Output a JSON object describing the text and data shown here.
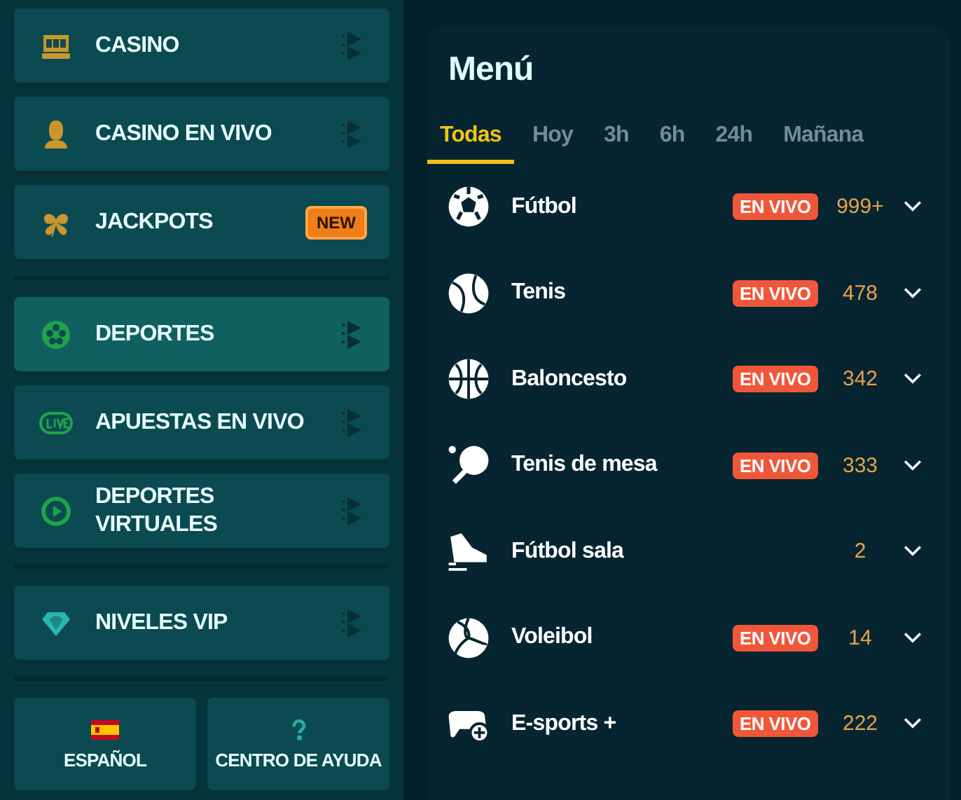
{
  "sidebar": {
    "groups": [
      {
        "items": [
          {
            "label": "CASINO",
            "selected": false
          },
          {
            "label": "CASINO EN VIVO",
            "selected": false
          },
          {
            "label": "JACKPOTS",
            "selected": false,
            "badge": "NEW"
          }
        ]
      },
      {
        "items": [
          {
            "label": "DEPORTES",
            "selected": true
          },
          {
            "label": "APUESTAS EN VIVO",
            "selected": false
          },
          {
            "label": "DEPORTES VIRTUALES",
            "selected": false
          }
        ]
      },
      {
        "items": [
          {
            "label": "NIVELES VIP",
            "selected": false
          }
        ]
      }
    ],
    "footer_buttons": [
      {
        "label": "ESPAÑOL",
        "kind": "language"
      },
      {
        "label": "CENTRO DE AYUDA",
        "kind": "help"
      }
    ]
  },
  "menu": {
    "title": "Menú",
    "tabs": [
      {
        "label": "Todas",
        "selected": true
      },
      {
        "label": "Hoy",
        "selected": false
      },
      {
        "label": "3h",
        "selected": false
      },
      {
        "label": "6h",
        "selected": false
      },
      {
        "label": "24h",
        "selected": false
      },
      {
        "label": "Mañana",
        "selected": false
      }
    ],
    "sports": [
      {
        "name": "Fútbol",
        "badge": "EN VIVO",
        "count": "999+"
      },
      {
        "name": "Tenis",
        "badge": "EN VIVO",
        "count": "478"
      },
      {
        "name": "Baloncesto",
        "badge": "EN VIVO",
        "count": "342"
      },
      {
        "name": "Tenis de mesa",
        "badge": "EN VIVO",
        "count": "333"
      },
      {
        "name": "Fútbol sala",
        "count": "2"
      },
      {
        "name": "Voleibol",
        "badge": "EN VIVO",
        "count": "14"
      },
      {
        "name": "E-sports +",
        "badge": "EN VIVO",
        "count": "222"
      }
    ]
  }
}
